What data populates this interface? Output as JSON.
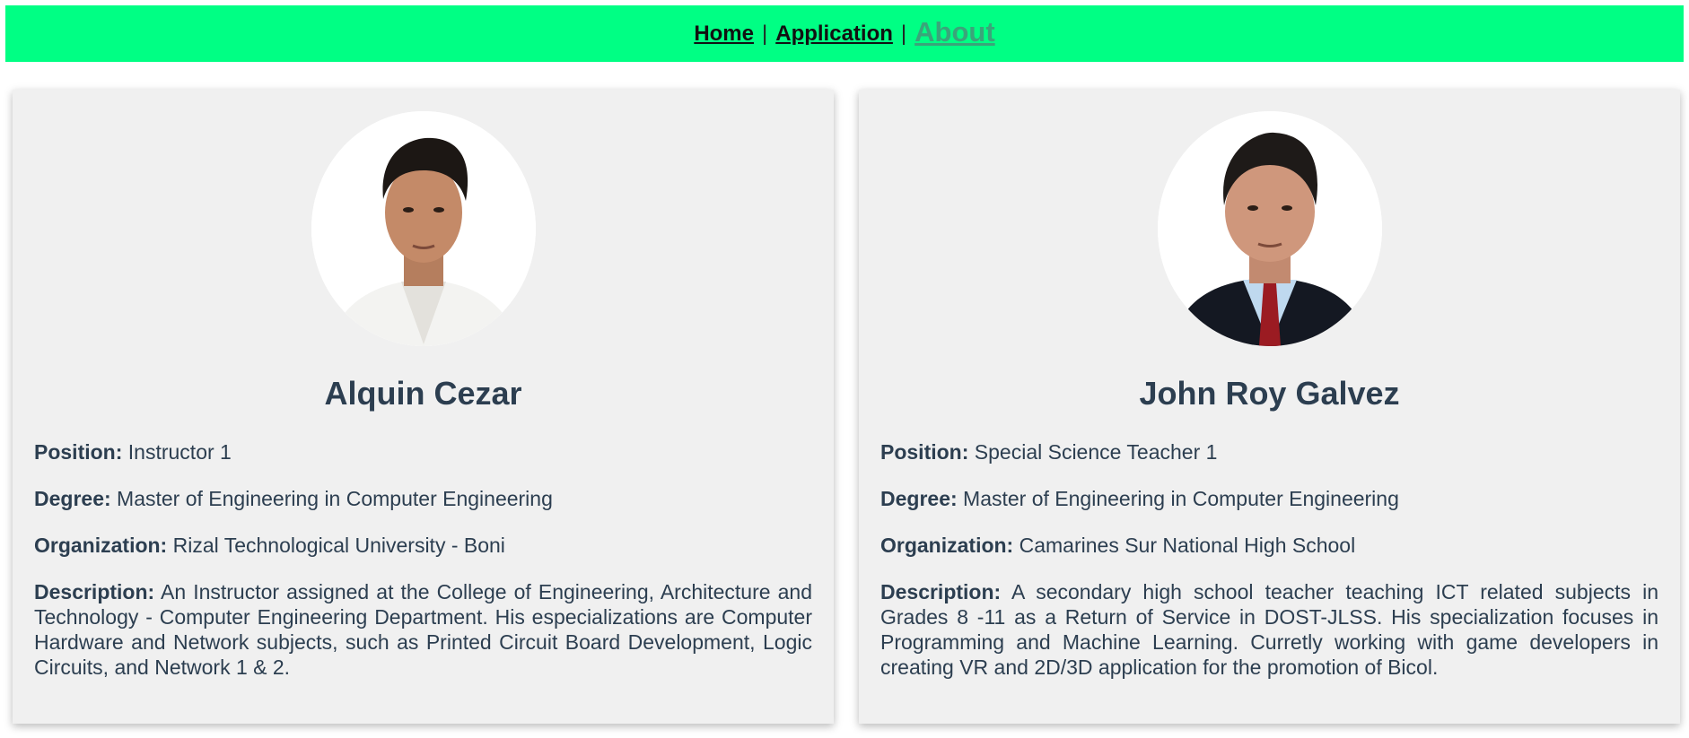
{
  "nav": {
    "home": "Home",
    "application": "Application",
    "about": "About",
    "separator": "|"
  },
  "members": [
    {
      "name": "Alquin Cezar",
      "position_label": "Position:",
      "position": "Instructor 1",
      "degree_label": "Degree:",
      "degree": "Master of Engineering in Computer Engineering",
      "organization_label": "Organization:",
      "organization": "Rizal Technological University - Boni",
      "description_label": "Description:",
      "description": "An Instructor assigned at the College of Engineering, Architecture and Technology - Computer Engineering Department. His especializations are Computer Hardware and Network subjects, such as Printed Circuit Board Development, Logic Circuits, and Network 1 & 2."
    },
    {
      "name": "John Roy Galvez",
      "position_label": "Position:",
      "position": "Special Science Teacher 1",
      "degree_label": "Degree:",
      "degree": "Master of Engineering in Computer Engineering",
      "organization_label": "Organization:",
      "organization": "Camarines Sur National High School",
      "description_label": "Description:",
      "description": "A secondary high school teacher teaching ICT related subjects in Grades 8 -11 as a Return of Service in DOST-JLSS. His specialization focuses in Programming and Machine Learning. Curretly working with game developers in creating VR and 2D/3D application for the promotion of Bicol."
    }
  ],
  "colors": {
    "nav_bg": "#00ff84",
    "card_bg": "#f0f0f0",
    "text": "#2c3e50",
    "active_link": "#3aa57a"
  }
}
